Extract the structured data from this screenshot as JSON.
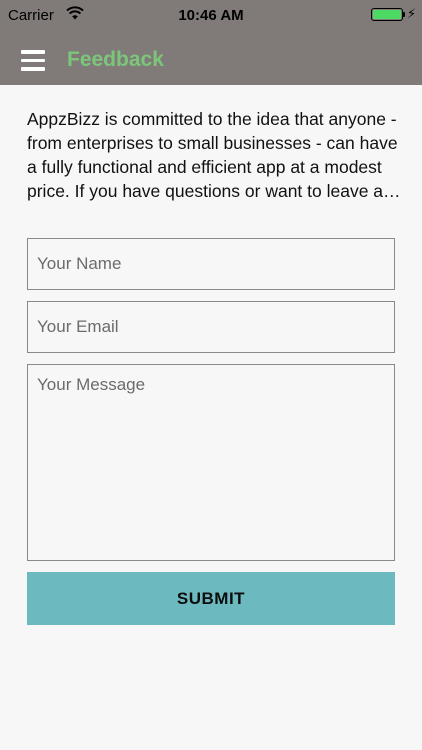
{
  "status_bar": {
    "carrier": "Carrier",
    "time": "10:46 AM",
    "battery_level": 1.0,
    "wifi_icon": "wifi-icon",
    "charging_icon": "bolt-icon"
  },
  "header": {
    "menu_icon": "hamburger-menu-icon",
    "title": "Feedback",
    "title_color": "#7cc679",
    "background_color": "#807b79"
  },
  "intro_text": "AppzBizz is committed to the idea that anyone - from enterprises to small businesses - can have a fully functional and efficient app at a modest price. If you have questions or want to leave a com...",
  "form": {
    "name_placeholder": "Your Name",
    "name_value": "",
    "email_placeholder": "Your Email",
    "email_value": "",
    "message_placeholder": "Your Message",
    "message_value": "",
    "submit_label": "SUBMIT",
    "submit_color": "#6cbabf"
  }
}
